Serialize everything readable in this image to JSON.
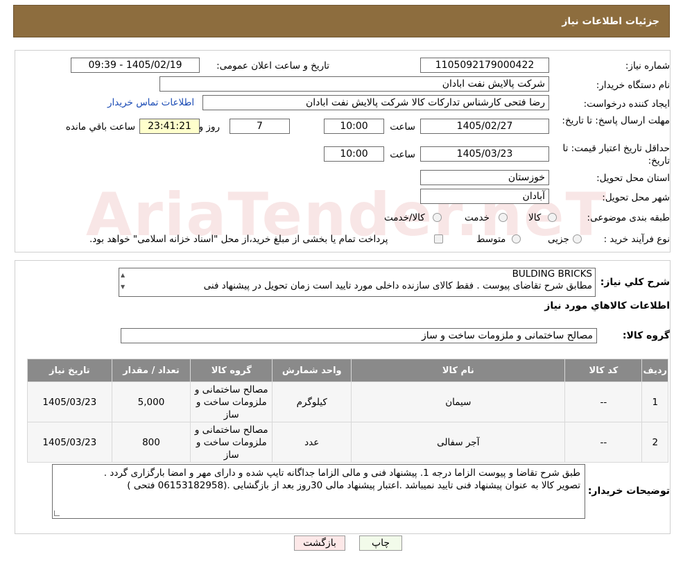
{
  "header": {
    "title": "جزئیات اطلاعات نیاز"
  },
  "info": {
    "need_number_label": "شماره نیاز:",
    "need_number": "1105092179000422",
    "announce_label": "تاریخ و ساعت اعلان عمومی:",
    "announce_value": "1405/02/19 - 09:39",
    "buyer_org_label": "نام دستگاه خریدار:",
    "buyer_org": "شرکت پالایش نفت ابادان",
    "creator_label": "ایجاد کننده درخواست:",
    "creator": "رضا فتحی کارشناس تدارکات کالا  شرکت پالایش نفت ابادان",
    "contact_link": "اطلاعات تماس خریدار",
    "reply_deadline_label": "مهلت ارسال پاسخ: تا تاریخ:",
    "reply_date": "1405/02/27",
    "time_label": "ساعت",
    "reply_time": "10:00",
    "days_value": "7",
    "days_label": "روز و",
    "remaining_time": "23:41:21",
    "remaining_label": "ساعت باقي مانده",
    "validity_label": "حداقل تاریخ اعتبار قیمت: تا تاریخ:",
    "validity_date": "1405/03/23",
    "validity_time": "10:00",
    "province_label": "استان محل تحویل:",
    "province": "خوزستان",
    "city_label": "شهر محل تحویل:",
    "city": "آبادان",
    "category_label": "طبقه بندی موضوعی:",
    "category_options": [
      "کالا",
      "خدمت",
      "کالا/خدمت"
    ],
    "process_label": "نوع فرآیند خرید :",
    "process_options": [
      "جزیی",
      "متوسط"
    ],
    "process_note": "پرداخت تمام یا بخشی از مبلغ خرید،از محل \"اسناد خزانه اسلامی\" خواهد بود."
  },
  "watermark": "AriaTender.neT",
  "summary": {
    "label": "شرح کلي نياز:",
    "line1": "BULDING BRICKS",
    "line2": "مطابق شرح تقاضای پیوست .  فقط کالای سازنده داخلی مورد تایید است  زمان تحویل در پیشنهاد فنی"
  },
  "items_section": {
    "title": "اطلاعات کالاهاي مورد نياز",
    "group_label": "گروه کالا:",
    "group_value": "مصالح ساختمانی و ملزومات ساخت و ساز",
    "columns": [
      "رديف",
      "کد کالا",
      "نام کالا",
      "واحد شمارش",
      "گروه کالا",
      "تعداد / مقدار",
      "تاریخ نیاز"
    ],
    "rows": [
      {
        "row": "1",
        "code": "--",
        "name": "سیمان",
        "unit": "کیلوگرم",
        "group": "مصالح ساختمانی و ملزومات ساخت و ساز",
        "qty": "5,000",
        "date": "1405/03/23"
      },
      {
        "row": "2",
        "code": "--",
        "name": "آجر سفالی",
        "unit": "عدد",
        "group": "مصالح ساختمانی و ملزومات ساخت و ساز",
        "qty": "800",
        "date": "1405/03/23"
      }
    ]
  },
  "buyer_notes": {
    "label": "توضیحات خریدار:",
    "line1": "طبق شرح تقاضا و پیوست الزاما درجه 1. پیشنهاد فنی و مالی الزاما جداگانه تایپ شده و دارای مهر و امضا بارگزاری گردد .",
    "line2": "تصویر کالا به عنوان پیشنهاد فنی تایید نمیباشد .اعتبار پیشنهاد مالی 30روز بعد از بازگشایی .(06153182958 فتحی )"
  },
  "buttons": {
    "print": "چاپ",
    "back": "بازگشت"
  },
  "colors": {
    "header": "#8d6d3e",
    "table_header": "#8a8a8a",
    "highlight": "#ffffcc",
    "link": "#1a4bb5"
  }
}
